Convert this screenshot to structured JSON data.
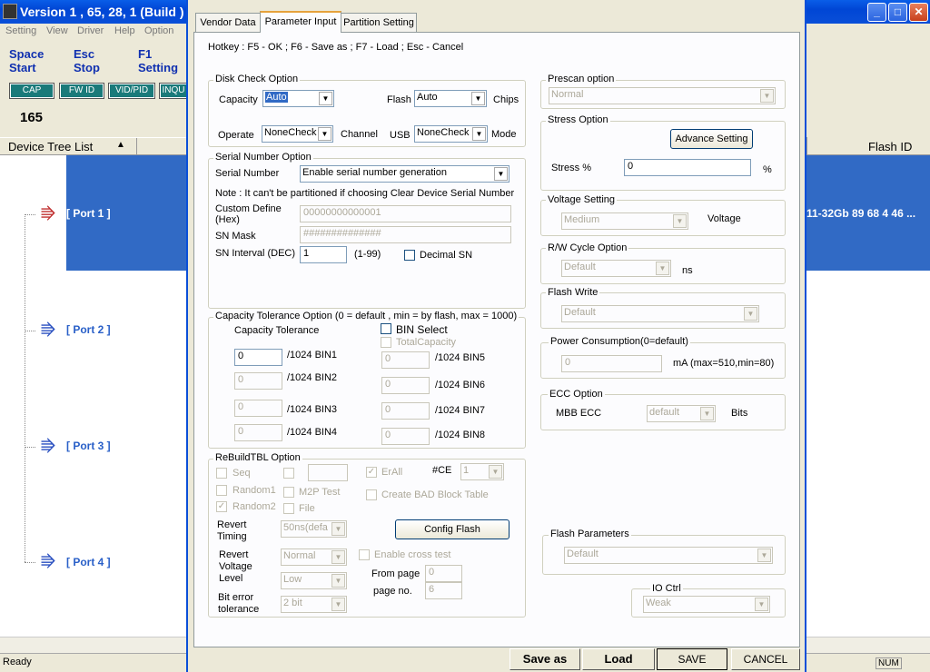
{
  "window": {
    "title": "Version 1 , 65, 28, 1 (Build )",
    "min": "_",
    "max": "□",
    "close": "✕"
  },
  "menu": [
    "Setting",
    "View",
    "Driver",
    "Help",
    "Option"
  ],
  "hotkeys": [
    {
      "key": "Space",
      "action": "Start"
    },
    {
      "key": "Esc",
      "action": "Stop"
    },
    {
      "key": "F1",
      "action": "Setting"
    }
  ],
  "toolbar": [
    "CAP",
    "FW ID",
    "VID/PID",
    "INQU"
  ],
  "count": "165",
  "tree": {
    "header": "Device Tree List",
    "sort_icon": "▲",
    "flash_header": "Flash ID",
    "ports": [
      "[ Port  1 ]",
      "[ Port  2 ]",
      "[ Port  3 ]",
      "[ Port  4 ]"
    ],
    "flash_id": "11-32Gb 89 68 4 46 ..."
  },
  "status": {
    "ready": "Ready",
    "num": "NUM"
  },
  "dialog": {
    "tabs": [
      "Vendor Data",
      "Parameter Input",
      "Partition Setting"
    ],
    "hotkey_line": "Hotkey : F5 - OK ; F6 - Save as ; F7 - Load ; Esc - Cancel",
    "disk_check": {
      "title": "Disk Check Option",
      "capacity_label": "Capacity",
      "capacity_value": "Auto",
      "flash_label": "Flash",
      "flash_value": "Auto",
      "chips_label": "Chips",
      "operate_label": "Operate",
      "operate_value": "NoneCheck",
      "channel_label": "Channel",
      "usb_label": "USB",
      "usb_value": "NoneCheck",
      "mode_label": "Mode"
    },
    "serial": {
      "title": "Serial Number Option",
      "sn_label": "Serial Number",
      "sn_value": "Enable serial number generation",
      "note": "Note : It can't be partitioned if choosing Clear Device Serial Number",
      "custom_label_1": "Custom Define",
      "custom_label_2": "(Hex)",
      "custom_value": "00000000000001",
      "mask_label": "SN Mask",
      "mask_value": "##############",
      "interval_label": "SN Interval (DEC)",
      "interval_value": "1",
      "interval_range": "(1-99)",
      "decimal_label": "Decimal SN"
    },
    "tolerance": {
      "title": "Capacity Tolerance Option (0 = default , min = by flash, max = 1000)",
      "sub": "Capacity Tolerance",
      "bin_select": "BIN Select",
      "total_capacity": "TotalCapacity",
      "bins": [
        {
          "value": "0",
          "label": "/1024 BIN1"
        },
        {
          "value": "0",
          "label": "/1024 BIN2"
        },
        {
          "value": "0",
          "label": "/1024 BIN3"
        },
        {
          "value": "0",
          "label": "/1024 BIN4"
        },
        {
          "value": "0",
          "label": "/1024 BIN5"
        },
        {
          "value": "0",
          "label": "/1024 BIN6"
        },
        {
          "value": "0",
          "label": "/1024 BIN7"
        },
        {
          "value": "0",
          "label": "/1024 BIN8"
        }
      ]
    },
    "rebuild": {
      "title": "ReBuildTBL Option",
      "seq": "Seq",
      "erall": "ErAll",
      "ce_label": "#CE",
      "ce_value": "1",
      "random1": "Random1",
      "m2p": "M2P Test",
      "create_bad": "Create BAD Block Table",
      "random2": "Random2",
      "file": "File",
      "revert_timing_1": "Revert",
      "revert_timing_2": "Timing",
      "revert_timing_value": "50ns(defa",
      "config_flash": "Config Flash",
      "revert_voltage_1": "Revert",
      "revert_voltage_2": "Voltage",
      "revert_voltage_3": "Level",
      "revert_voltage_value": "Normal",
      "low_value": "Low",
      "cross_test": "Enable cross test",
      "from_page": "From page",
      "from_page_value": "0",
      "page_no": "page no.",
      "page_no_value": "6",
      "bit_error_1": "Bit error",
      "bit_error_2": "tolerance",
      "bit_error_value": "2 bit"
    },
    "prescan": {
      "title": "Prescan option",
      "value": "Normal"
    },
    "stress": {
      "title": "Stress Option",
      "advance": "Advance Setting",
      "label": "Stress %",
      "value": "0",
      "unit": "%"
    },
    "voltage": {
      "title": "Voltage Setting",
      "value": "Medium",
      "label": "Voltage"
    },
    "rw_cycle": {
      "title": "R/W Cycle Option",
      "value": "Default",
      "unit": "ns"
    },
    "flash_write": {
      "title": "Flash Write",
      "value": "Default"
    },
    "power": {
      "title": "Power Consumption(0=default)",
      "value": "0",
      "unit": "mA (max=510,min=80)"
    },
    "ecc": {
      "title": "ECC Option",
      "label": "MBB ECC",
      "value": "default",
      "unit": "Bits"
    },
    "flash_params": {
      "title": "Flash Parameters",
      "value": "Default"
    },
    "io_ctrl": {
      "title": "IO Ctrl",
      "value": "Weak"
    },
    "buttons": {
      "save_as": "Save as",
      "load": "Load",
      "save": "SAVE",
      "cancel": "CANCEL"
    }
  }
}
